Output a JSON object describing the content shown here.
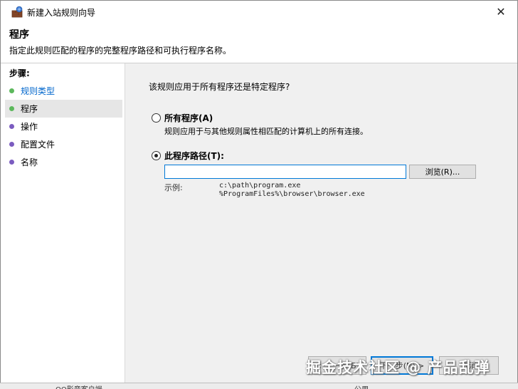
{
  "window": {
    "title": "新建入站规则向导",
    "close_glyph": "✕"
  },
  "header": {
    "title": "程序",
    "description": "指定此规则匹配的程序的完整程序路径和可执行程序名称。"
  },
  "steps": {
    "label": "步骤:",
    "items": [
      {
        "label": "规则类型",
        "color": "#5cb85c",
        "link": true
      },
      {
        "label": "程序",
        "color": "#5cb85c",
        "active": true
      },
      {
        "label": "操作",
        "color": "#7b5cc0"
      },
      {
        "label": "配置文件",
        "color": "#7b5cc0"
      },
      {
        "label": "名称",
        "color": "#7b5cc0"
      }
    ]
  },
  "main": {
    "question": "该规则应用于所有程序还是特定程序?",
    "option_all": {
      "label": "所有程序(A)",
      "description": "规则应用于与其他规则属性相匹配的计算机上的所有连接。",
      "selected": false
    },
    "option_path": {
      "label": "此程序路径(T):",
      "selected": true,
      "value": "",
      "browse_label": "浏览(R)..."
    },
    "example": {
      "label": "示例:",
      "line1": "c:\\path\\program.exe",
      "line2": "%ProgramFiles%\\browser\\browser.exe"
    }
  },
  "buttons": {
    "back": "< 上一步(B)",
    "next": "下一步(N) >",
    "cancel": "取消"
  },
  "watermark": "掘金技术社区 @ 产品乱弹",
  "background": {
    "item": "QQ影音客户端",
    "value": "公用"
  },
  "colors": {
    "accent": "#0078d7",
    "link": "#0066cc"
  }
}
